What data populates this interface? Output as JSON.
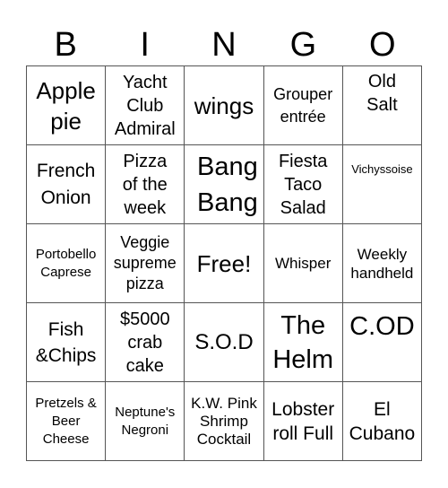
{
  "header": [
    "B",
    "I",
    "N",
    "G",
    "O"
  ],
  "cells": [
    [
      "Apple pie",
      "Yacht Club Admiral",
      "wings",
      "Grouper entrée",
      "Old Salt"
    ],
    [
      "French Onion",
      "Pizza of the week",
      "Bang Bang",
      "Fiesta Taco Salad",
      "Vichyssoise"
    ],
    [
      "Portobello Caprese",
      "Veggie supreme pizza",
      "Free!",
      "Whisper",
      "Weekly handheld"
    ],
    [
      "Fish &Chips",
      "$5000 crab cake",
      "S.O.D",
      "The Helm",
      "C.OD"
    ],
    [
      "Pretzels & Beer Cheese",
      "Neptune's Negroni",
      "K.W. Pink Shrimp Cocktail",
      "Lobster roll Full",
      "El Cubano"
    ]
  ]
}
